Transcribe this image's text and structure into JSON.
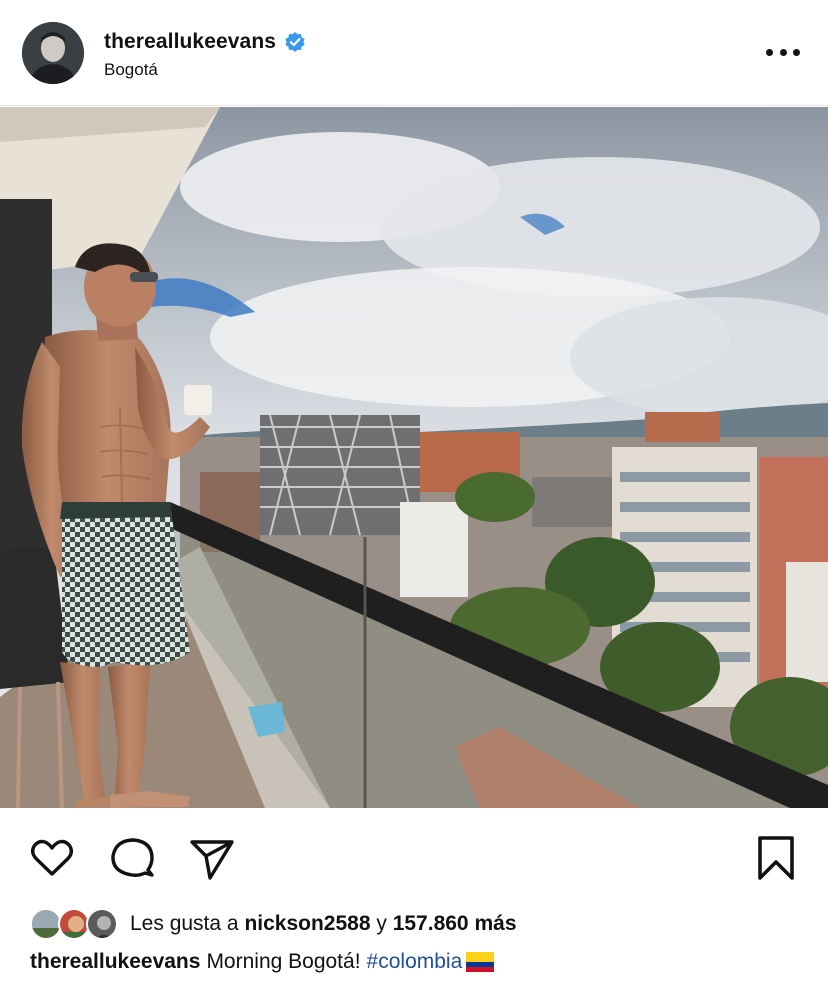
{
  "post": {
    "username": "thereallukeevans",
    "location": "Bogotá",
    "verified": true,
    "icons": {
      "avatar": "profile-avatar",
      "verified": "verified-badge-icon",
      "more": "more-options-icon",
      "like": "heart-icon",
      "comment": "comment-bubble-icon",
      "share": "paper-plane-icon",
      "save": "bookmark-icon"
    },
    "colors": {
      "verified_blue": "#3897f0",
      "hashtag": "#1f4f9b",
      "text": "#111111"
    }
  },
  "likes": {
    "prefix": "Les gusta a",
    "user": "nickson2588",
    "connector": "y",
    "count": "157.860",
    "suffix": "más"
  },
  "caption": {
    "username": "thereallukeevans",
    "text": "Morning Bogotá!",
    "hashtag": "#colombia",
    "emoji_name": "colombia-flag-icon"
  }
}
